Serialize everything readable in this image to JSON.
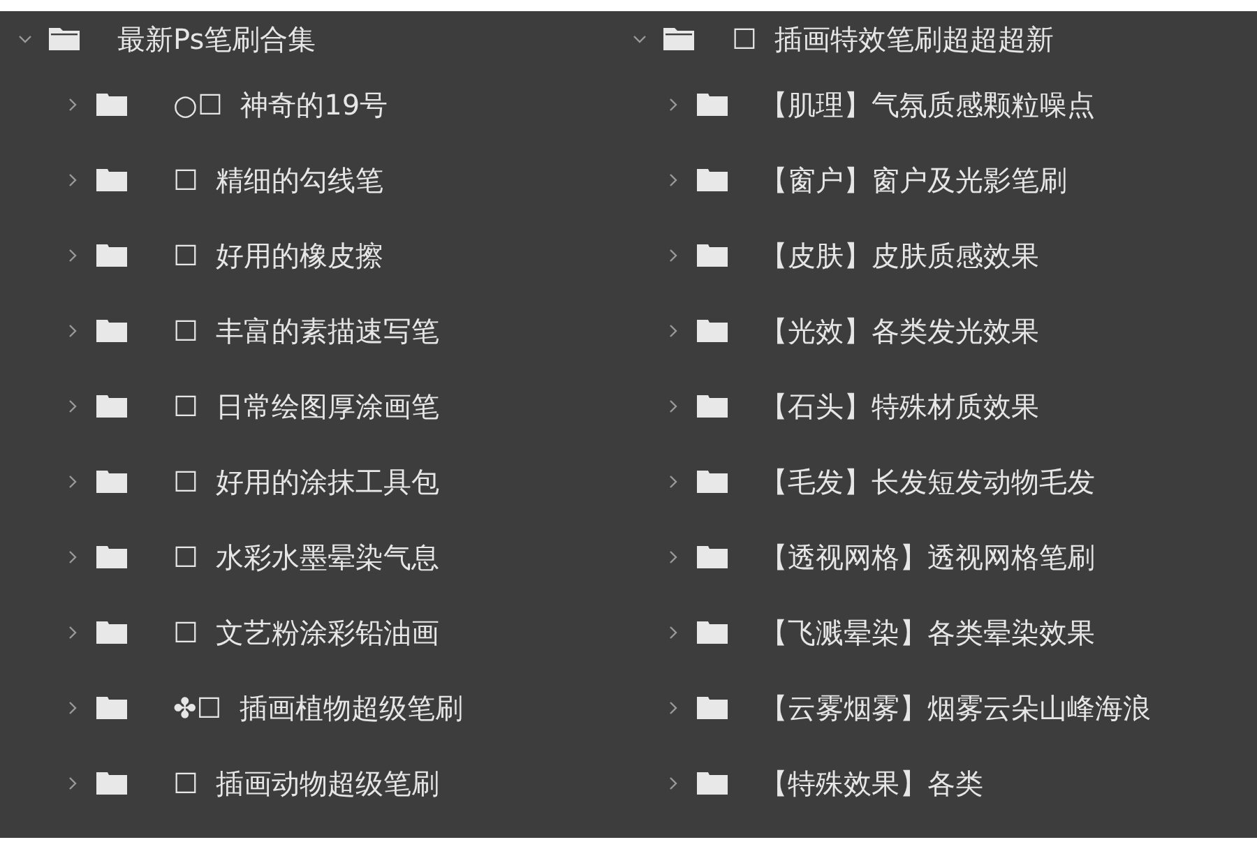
{
  "groups": [
    {
      "name": "最新Ps笔刷合集",
      "expanded": true,
      "children": [
        {
          "name": "○☐  神奇的19号",
          "expanded": false
        },
        {
          "name": "☐  精细的勾线笔",
          "expanded": false
        },
        {
          "name": "☐  好用的橡皮擦",
          "expanded": false
        },
        {
          "name": "☐  丰富的素描速写笔",
          "expanded": false
        },
        {
          "name": "☐  日常绘图厚涂画笔",
          "expanded": false
        },
        {
          "name": "☐  好用的涂抹工具包",
          "expanded": false
        },
        {
          "name": "☐  水彩水墨晕染气息",
          "expanded": false
        },
        {
          "name": "☐  文艺粉涂彩铅油画",
          "expanded": false
        },
        {
          "name": "✤☐  插画植物超级笔刷",
          "expanded": false
        },
        {
          "name": "☐  插画动物超级笔刷",
          "expanded": false
        }
      ]
    },
    {
      "name": "☐  插画特效笔刷超超超新",
      "expanded": true,
      "children": [
        {
          "name": "【肌理】气氛质感颗粒噪点",
          "expanded": false
        },
        {
          "name": "【窗户】窗户及光影笔刷",
          "expanded": false
        },
        {
          "name": "【皮肤】皮肤质感效果",
          "expanded": false
        },
        {
          "name": "【光效】各类发光效果",
          "expanded": false
        },
        {
          "name": "【石头】特殊材质效果",
          "expanded": false
        },
        {
          "name": "【毛发】长发短发动物毛发",
          "expanded": false
        },
        {
          "name": "【透视网格】透视网格笔刷",
          "expanded": false
        },
        {
          "name": "【飞溅晕染】各类晕染效果",
          "expanded": false
        },
        {
          "name": "【云雾烟雾】烟雾云朵山峰海浪",
          "expanded": false
        },
        {
          "name": "【特殊效果】各类",
          "expanded": false
        }
      ]
    }
  ]
}
